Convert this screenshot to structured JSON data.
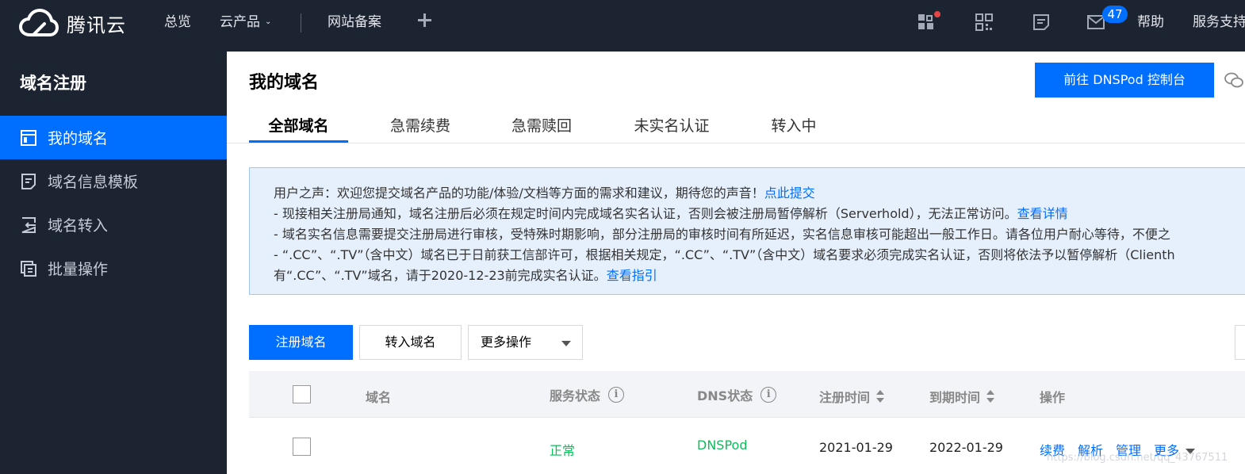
{
  "topbar": {
    "brand": "腾讯云",
    "nav": [
      {
        "label": "总览"
      },
      {
        "label": "云产品"
      },
      {
        "label": "网站备案"
      }
    ],
    "badge_count": "47",
    "help_label": "帮助",
    "service_label": "服务支持"
  },
  "sidebar": {
    "title": "域名注册",
    "items": [
      {
        "label": "我的域名",
        "icon": "window-icon",
        "active": true
      },
      {
        "label": "域名信息模板",
        "icon": "document-icon"
      },
      {
        "label": "域名转入",
        "icon": "transfer-icon"
      },
      {
        "label": "批量操作",
        "icon": "copy-icon"
      }
    ]
  },
  "main": {
    "title": "我的域名",
    "dnspod_button": "前往 DNSPod 控制台",
    "tabs": [
      {
        "label": "全部域名",
        "active": true
      },
      {
        "label": "急需续费"
      },
      {
        "label": "急需赎回"
      },
      {
        "label": "未实名认证"
      },
      {
        "label": "转入中"
      }
    ],
    "notice": {
      "line1": "用户之声：欢迎您提交域名产品的功能/体验/文档等方面的需求和建议，期待您的声音！",
      "line1_link": "点此提交",
      "line2": "- 现接相关注册局通知，域名注册后必须在规定时间内完成域名实名认证，否则会被注册局暂停解析（Serverhold），无法正常访问。",
      "line2_link": "查看详情",
      "line3": "- 域名实名信息需要提交注册局进行审核，受特殊时期影响，部分注册局的审核时间有所延迟，实名信息审核可能超出一般工作日。请各位用户耐心等待，不便之",
      "line4": "- “.CC”、“.TV”（含中文）域名已于日前获工信部许可，根据相关规定，“.CC”、“.TV”（含中文）域名要求必须完成实名认证，否则将依法予以暂停解析（Clienth",
      "line5": "有“.CC”、“.TV”域名，请于2020-12-23前完成实名认证。",
      "line5_link": "查看指引"
    },
    "toolbar": {
      "register_label": "注册域名",
      "transfer_label": "转入域名",
      "more_label": "更多操作"
    },
    "table": {
      "headers": {
        "domain": "域名",
        "service_status": "服务状态",
        "dns_status": "DNS状态",
        "reg_time": "注册时间",
        "exp_time": "到期时间",
        "actions": "操作"
      },
      "rows": [
        {
          "service_status": "正常",
          "dns_status": "DNSPod",
          "reg_time": "2021-01-29",
          "exp_time": "2022-01-29",
          "actions": [
            "续费",
            "解析",
            "管理",
            "更多"
          ]
        }
      ]
    }
  },
  "watermark": "https://blog.csdn.net/qq_43767511",
  "colors": {
    "topbar_bg": "#1d2431",
    "accent": "#006eff",
    "success": "#0abf5b",
    "notice_bg": "#e6f0fd"
  }
}
